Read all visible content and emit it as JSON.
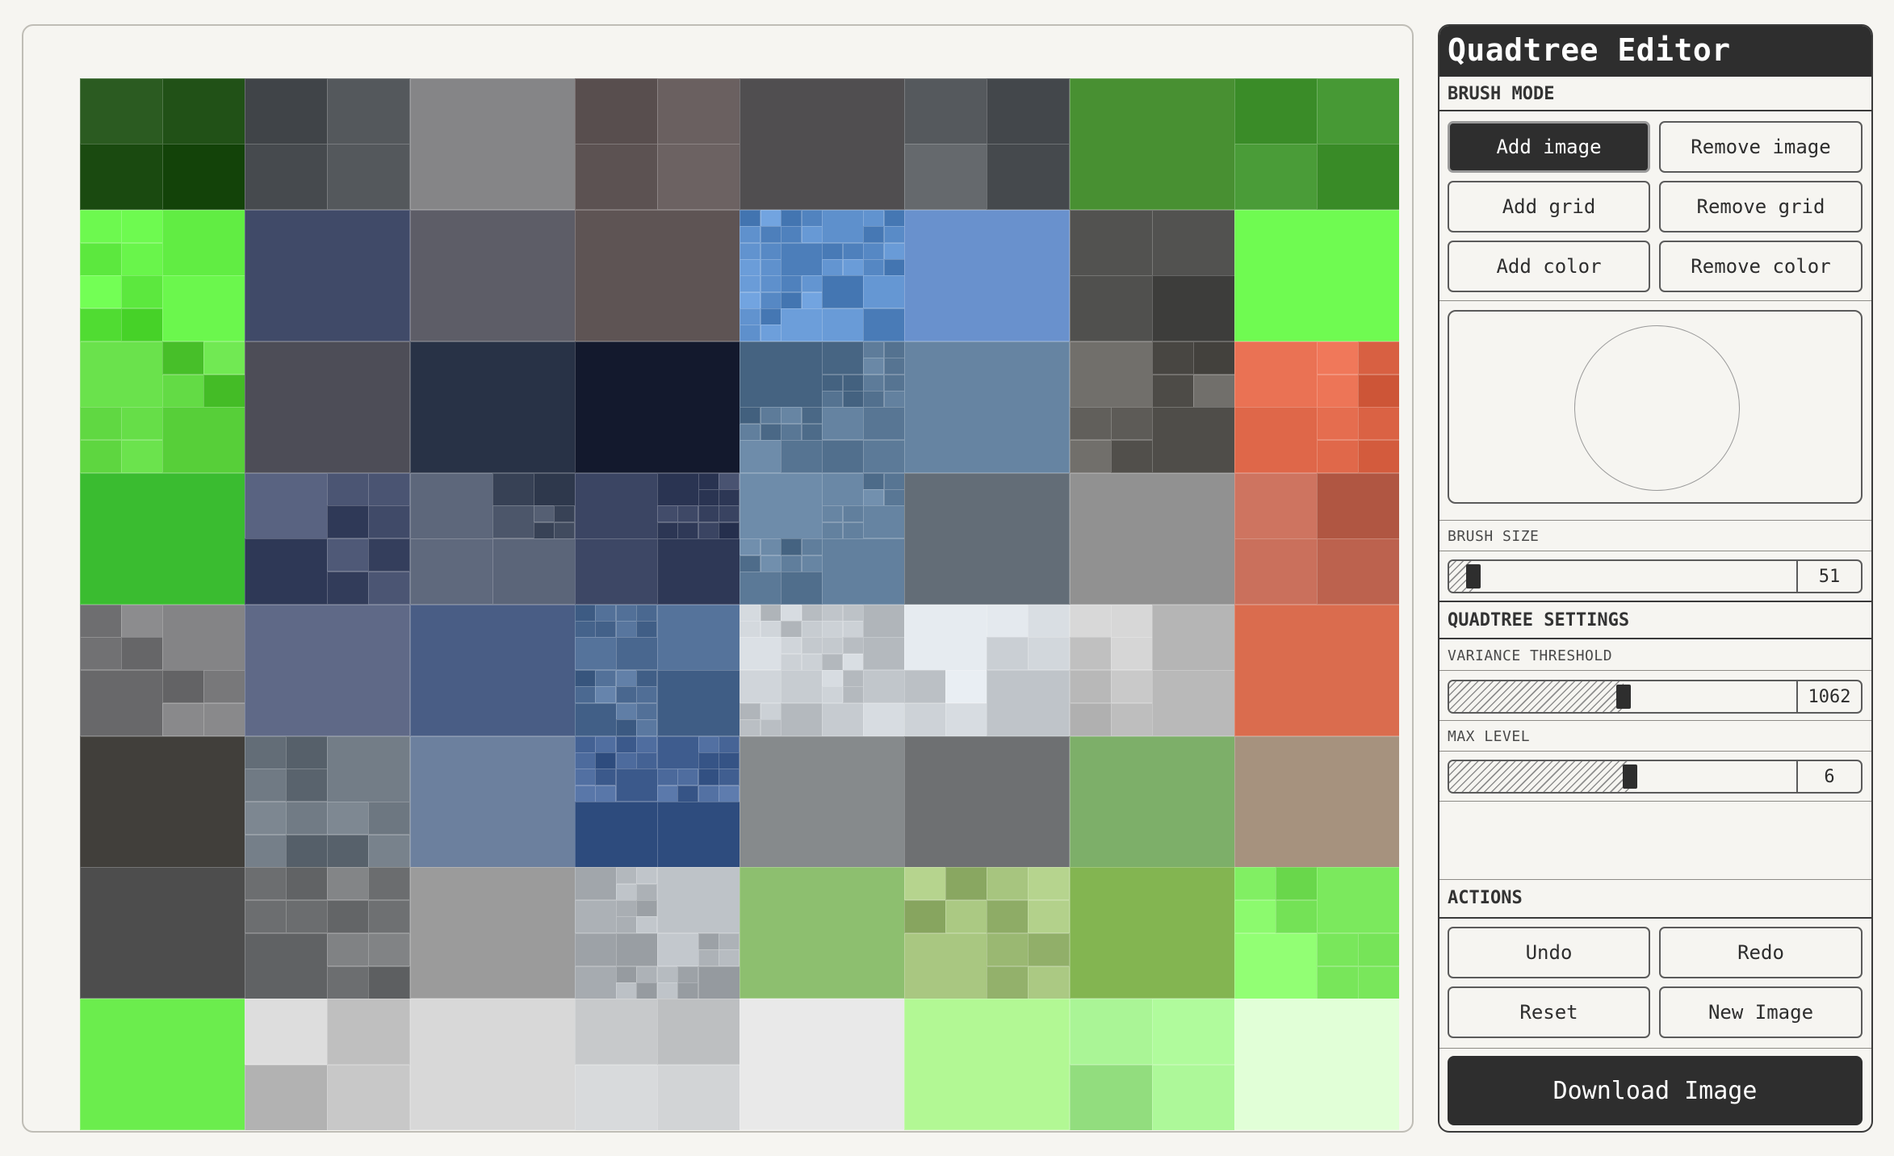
{
  "app": {
    "title": "Quadtree Editor"
  },
  "brush_mode": {
    "label": "BRUSH MODE",
    "buttons": [
      {
        "label": "Add image",
        "active": true
      },
      {
        "label": "Remove image",
        "active": false
      },
      {
        "label": "Add grid",
        "active": false
      },
      {
        "label": "Remove grid",
        "active": false
      },
      {
        "label": "Add color",
        "active": false
      },
      {
        "label": "Remove color",
        "active": false
      }
    ]
  },
  "brush_size": {
    "label": "BRUSH SIZE",
    "value": "51",
    "fraction": 0.05
  },
  "quadtree_settings": {
    "label": "QUADTREE SETTINGS",
    "variance_threshold": {
      "label": "VARIANCE THRESHOLD",
      "value": "1062",
      "fraction": 0.5
    },
    "max_level": {
      "label": "MAX LEVEL",
      "value": "6",
      "fraction": 0.52
    }
  },
  "actions": {
    "label": "ACTIONS",
    "undo": "Undo",
    "redo": "Redo",
    "reset": "Reset",
    "new_image": "New Image",
    "download": "Download Image"
  }
}
